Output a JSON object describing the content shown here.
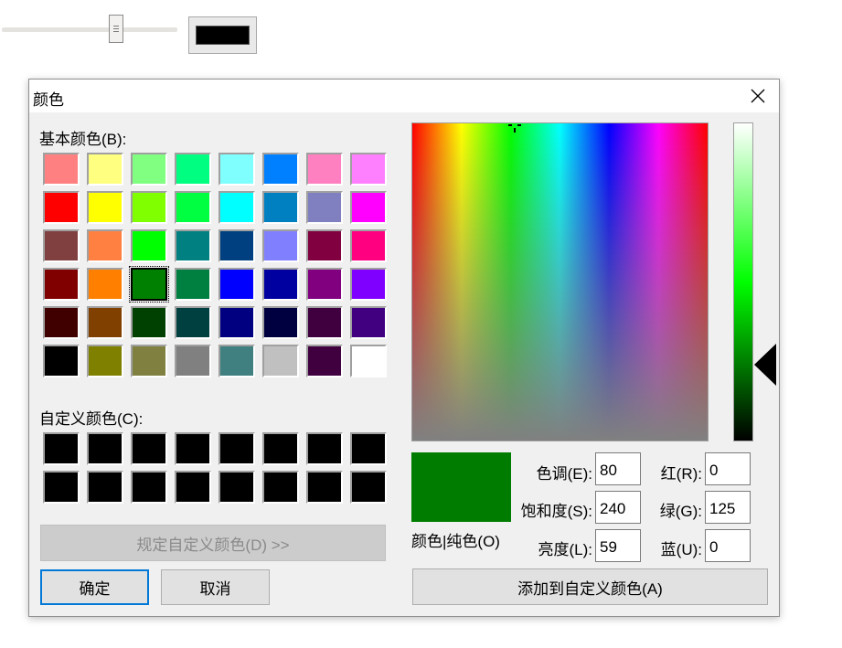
{
  "dialog": {
    "title": "颜色",
    "basic_colors_label": "基本颜色(B):",
    "custom_colors_label": "自定义颜色(C):",
    "define_custom_button": "规定自定义颜色(D) >>",
    "ok_button": "确定",
    "cancel_button": "取消",
    "add_to_custom_button": "添加到自定义颜色(A)",
    "preview_label": "颜色|纯色(O)"
  },
  "fields": {
    "hue_label": "色调(E):",
    "hue": "80",
    "sat_label": "饱和度(S):",
    "sat": "240",
    "lum_label": "亮度(L):",
    "lum": "59",
    "red_label": "红(R):",
    "red": "0",
    "green_label": "绿(G):",
    "green": "125",
    "blue_label": "蓝(U):",
    "blue": "0"
  },
  "basic_colors": [
    "#ff8080",
    "#ffff80",
    "#80ff80",
    "#00ff80",
    "#80ffff",
    "#0080ff",
    "#ff80c0",
    "#ff80ff",
    "#ff0000",
    "#ffff00",
    "#80ff00",
    "#00ff40",
    "#00ffff",
    "#0080c0",
    "#8080c0",
    "#ff00ff",
    "#804040",
    "#ff8040",
    "#00ff00",
    "#008080",
    "#004080",
    "#8080ff",
    "#800040",
    "#ff0080",
    "#800000",
    "#ff8000",
    "#008000",
    "#008040",
    "#0000ff",
    "#0000a0",
    "#800080",
    "#8000ff",
    "#400000",
    "#804000",
    "#004000",
    "#004040",
    "#000080",
    "#000040",
    "#400040",
    "#400080",
    "#000000",
    "#808000",
    "#808040",
    "#808080",
    "#408080",
    "#c0c0c0",
    "#400040",
    "#ffffff"
  ],
  "selected_basic_index": 26,
  "custom_colors": [
    "#000000",
    "#000000",
    "#000000",
    "#000000",
    "#000000",
    "#000000",
    "#000000",
    "#000000",
    "#000000",
    "#000000",
    "#000000",
    "#000000",
    "#000000",
    "#000000",
    "#000000",
    "#000000"
  ],
  "current_color": "#007d00",
  "toolbar_swatch_color": "#000000"
}
